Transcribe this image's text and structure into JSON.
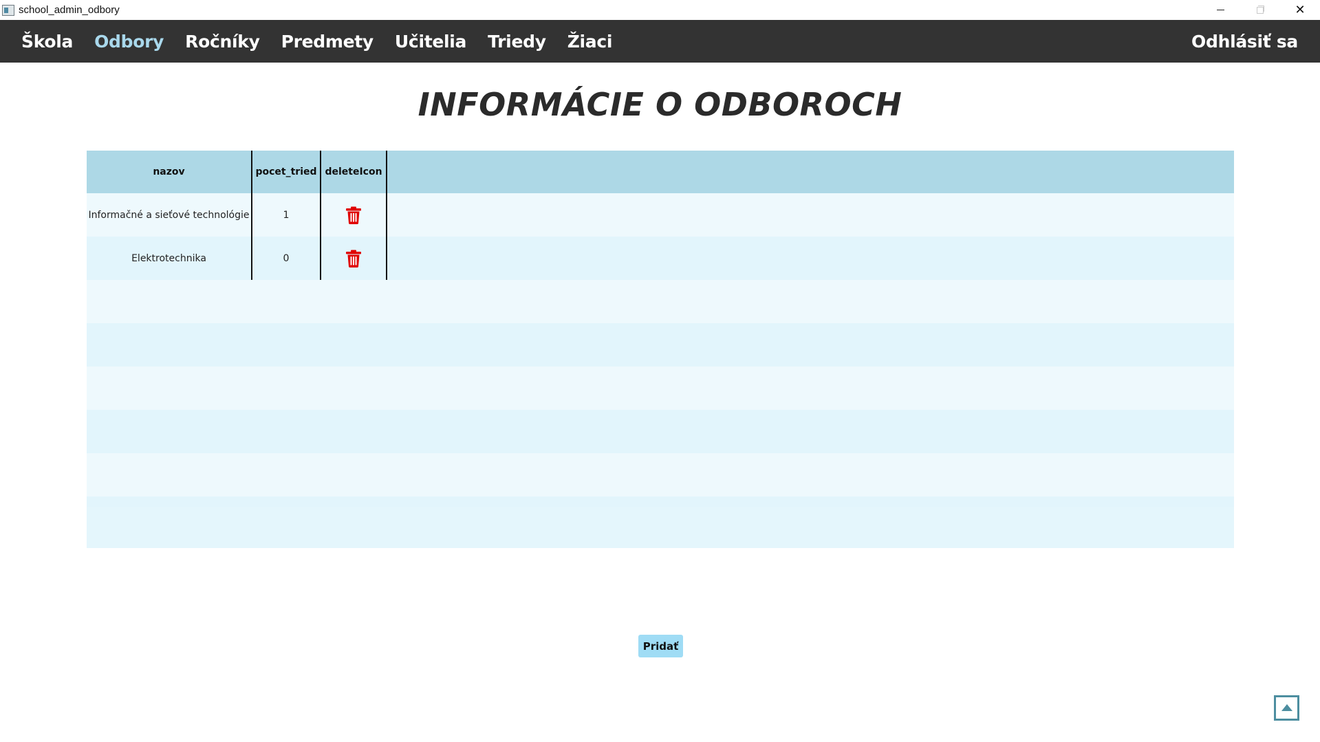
{
  "window": {
    "title": "school_admin_odbory",
    "minimize_icon": "minimize-icon",
    "maximize_icon": "maximize-icon",
    "close_icon": "close-icon",
    "close_glyph": "✕"
  },
  "nav": {
    "items": [
      {
        "label": "Škola",
        "active": false
      },
      {
        "label": "Odbory",
        "active": true
      },
      {
        "label": "Ročníky",
        "active": false
      },
      {
        "label": "Predmety",
        "active": false
      },
      {
        "label": "Učitelia",
        "active": false
      },
      {
        "label": "Triedy",
        "active": false
      },
      {
        "label": "Žiaci",
        "active": false
      }
    ],
    "logout": "Odhlásiť sa",
    "background": "#333333",
    "active_color": "#a9d8ec"
  },
  "page": {
    "title": "INFORMÁCIE O ODBOROCH"
  },
  "table": {
    "columns": [
      "nazov",
      "pocet_tried",
      "deleteIcon"
    ],
    "rows": [
      {
        "nazov": "Informačné a sieťové technológie",
        "pocet_tried": "1",
        "delete_icon": "trash-icon"
      },
      {
        "nazov": "Elektrotechnika",
        "pocet_tried": "0",
        "delete_icon": "trash-icon"
      }
    ],
    "header_color": "#add8e6",
    "delete_icon_color": "#e00000"
  },
  "actions": {
    "add_label": "Pridať",
    "add_color": "#9fdcf5"
  },
  "scroll_top_icon": "scroll-to-top-icon"
}
